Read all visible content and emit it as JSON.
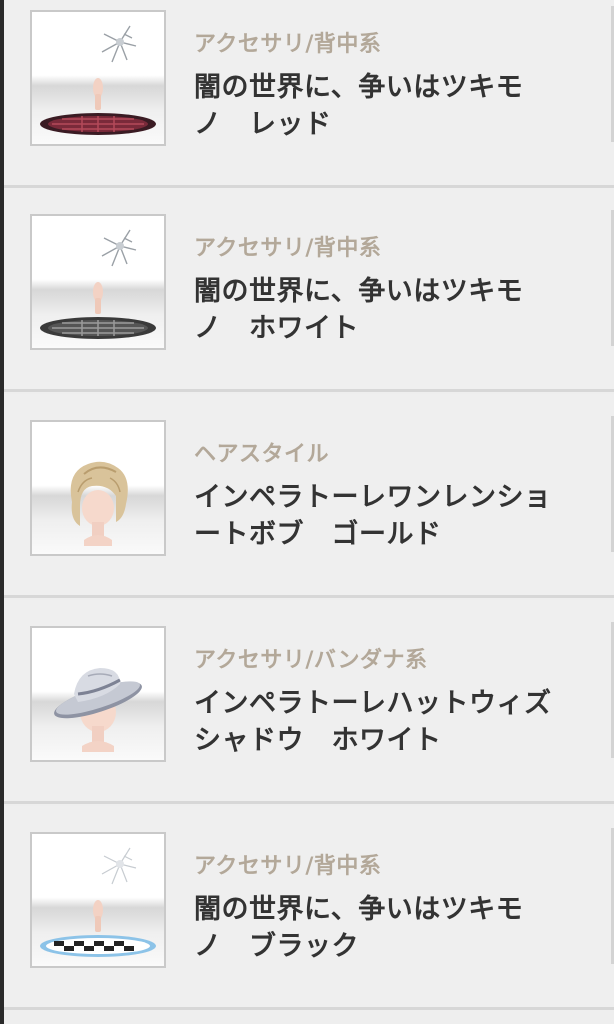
{
  "items": [
    {
      "category": "アクセサリ/背中系",
      "name_line1": "闇の世界に、争いはツキモ",
      "name_line2": "ノ　レッド",
      "thumb_icon": "back-accessory-red-icon",
      "thumb_color": "#7a2a3a"
    },
    {
      "category": "アクセサリ/背中系",
      "name_line1": "闇の世界に、争いはツキモ",
      "name_line2": "ノ　ホワイト",
      "thumb_icon": "back-accessory-white-icon",
      "thumb_color": "#555555"
    },
    {
      "category": "ヘアスタイル",
      "name_line1": "インペラトーレワンレンショ",
      "name_line2": "ートボブ　ゴールド",
      "thumb_icon": "hairstyle-gold-icon",
      "thumb_color": "#d9c39a"
    },
    {
      "category": "アクセサリ/バンダナ系",
      "name_line1": "インペラトーレハットウィズ",
      "name_line2": "シャドウ　ホワイト",
      "thumb_icon": "hat-white-icon",
      "thumb_color": "#b8bcc8"
    },
    {
      "category": "アクセサリ/背中系",
      "name_line1": "闇の世界に、争いはツキモ",
      "name_line2": "ノ　ブラック",
      "thumb_icon": "back-accessory-black-icon",
      "thumb_color": "#222222"
    }
  ]
}
